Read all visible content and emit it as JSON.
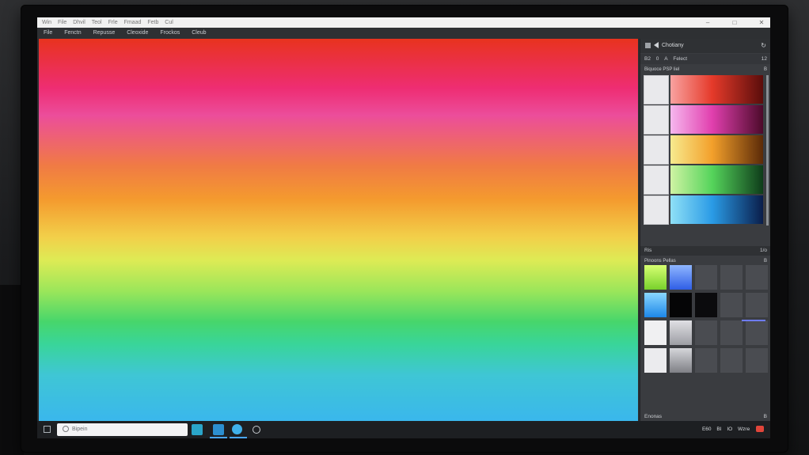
{
  "window": {
    "title_items": [
      "Win",
      "File",
      "Dhvil",
      "Teol",
      "Frle",
      "Fmaad",
      "Fetb",
      "Cul"
    ],
    "controls": [
      "–",
      "□",
      "✕"
    ]
  },
  "menu": {
    "items": [
      "File",
      "Fenctn",
      "Repusse",
      "Cleoxide",
      "Frockos",
      "Cleub"
    ]
  },
  "panel": {
    "title": "Chotiany",
    "toolbar": {
      "left": [
        "B2",
        "0",
        "A",
        "Felect"
      ],
      "right": "12"
    },
    "gradient_section_label": "Biquoce PSP liel",
    "gradient_section_right": "B",
    "divider_left": "Ris",
    "divider_right": "1/o",
    "swatch_section_label": "Pinoons Pellas",
    "swatch_section_right": "B",
    "footer_left": "Enonas",
    "footer_right": "B"
  },
  "taskbar": {
    "search_placeholder": "Bipein",
    "tray": [
      "E60",
      "BI",
      "IO",
      "Wzre"
    ]
  },
  "colors": {
    "canvas_gradient": [
      "#e8331e",
      "#ee2d73",
      "#f07a45",
      "#f2d04a",
      "#9be65a",
      "#47d66b",
      "#3fc6d5",
      "#3ab7ec"
    ],
    "panel_bg": "#3a3c40",
    "accent": "#4aa6ff"
  },
  "icons": [
    "start-icon",
    "search-icon",
    "app-icon",
    "browser-icon",
    "settings-icon",
    "refresh-icon",
    "back-icon"
  ]
}
